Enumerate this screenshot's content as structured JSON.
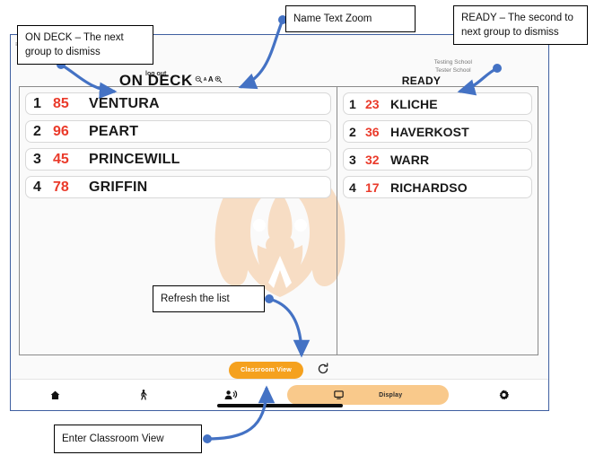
{
  "app": {
    "topleft_glyph": "≡",
    "logout_label": "log out",
    "school_line1": "Testing School",
    "school_line2": "Tester School"
  },
  "columns": [
    {
      "id": "on-deck",
      "title": "ON DECK",
      "has_text_zoom": true,
      "zoom_controls": {
        "zoom_out_icon": "magnifier-minus-icon",
        "small_a": "A",
        "large_a": "A",
        "zoom_in_icon": "magnifier-plus-icon"
      },
      "rows": [
        {
          "position": "1",
          "number": "85",
          "name": "VENTURA"
        },
        {
          "position": "2",
          "number": "96",
          "name": "PEART"
        },
        {
          "position": "3",
          "number": "45",
          "name": "PRINCEWILL"
        },
        {
          "position": "4",
          "number": "78",
          "name": "GRIFFIN"
        }
      ]
    },
    {
      "id": "ready",
      "title": "READY",
      "has_text_zoom": false,
      "rows": [
        {
          "position": "1",
          "number": "23",
          "name": "KLICHE"
        },
        {
          "position": "2",
          "number": "36",
          "name": "HAVERKOST"
        },
        {
          "position": "3",
          "number": "32",
          "name": "WARR"
        },
        {
          "position": "4",
          "number": "17",
          "name": "RICHARDSO"
        }
      ]
    }
  ],
  "actions": {
    "classroom_view_label": "Classroom View",
    "classroom_view_color": "#f5a11e",
    "refresh_icon": "refresh-icon"
  },
  "bottom_nav": {
    "items": [
      {
        "icon": "home-icon",
        "label": ""
      },
      {
        "icon": "walking-person-icon",
        "label": ""
      },
      {
        "icon": "person-announce-icon",
        "label": ""
      },
      {
        "icon": "monitor-icon",
        "label": "Display"
      },
      {
        "icon": "gear-icon",
        "label": ""
      }
    ],
    "display_label": "Display",
    "display_pill_color": "#f9c98b"
  },
  "annotations": [
    {
      "id": "callout-ondeck",
      "text": "ON DECK – The next group to dismiss"
    },
    {
      "id": "callout-nametextzoom",
      "text": "Name Text Zoom"
    },
    {
      "id": "callout-ready",
      "text": "READY – The second to next group to dismiss"
    },
    {
      "id": "callout-refresh",
      "text": "Refresh the list"
    },
    {
      "id": "callout-enter",
      "text": "Enter Classroom View"
    }
  ],
  "theme": {
    "accent_orange": "#f5a11e",
    "accent_orange_light": "#f9c98b",
    "number_red": "#ea3a2a",
    "frame_blue": "#3f5fa0",
    "annotation_blue": "#4472c4",
    "watermark_peach": "#f7ddc4"
  }
}
